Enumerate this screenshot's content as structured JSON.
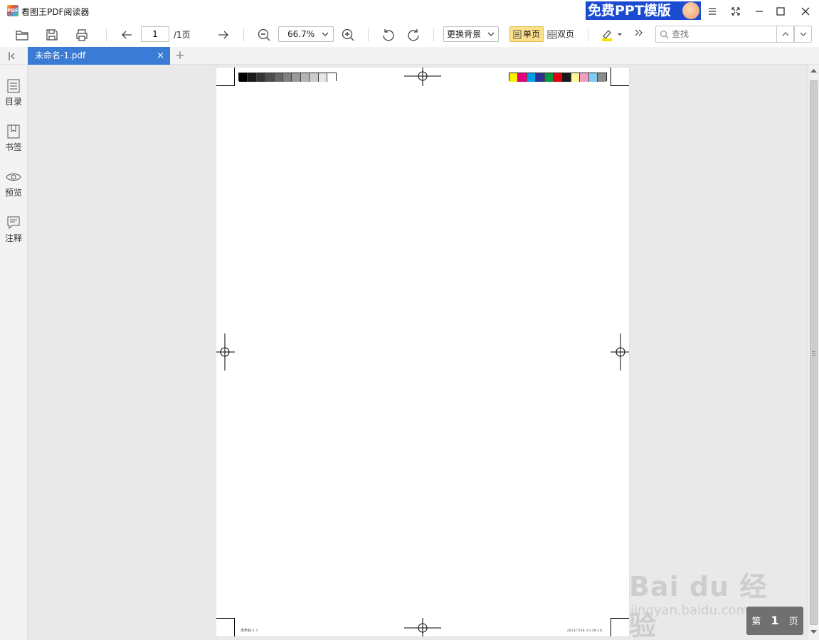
{
  "app": {
    "title": "看图王PDF阅读器",
    "logo_text": "PDF",
    "promo_label": "免费PPT模版"
  },
  "toolbar": {
    "page_current": "1",
    "page_total": "/1页",
    "zoom": "66.7%",
    "background_label": "更换背景",
    "single_page_label": "单页",
    "double_page_label": "双页",
    "search_placeholder": "查找",
    "highlight_color": "#f5e400"
  },
  "tabs": [
    {
      "label": "未命名-1.pdf",
      "close": "×"
    }
  ],
  "add_tab": "+",
  "sidebar": {
    "items": [
      {
        "label": "目录",
        "icon": "list-icon"
      },
      {
        "label": "书签",
        "icon": "bookmark-icon"
      },
      {
        "label": "预览",
        "icon": "eye-icon"
      },
      {
        "label": "注释",
        "icon": "comment-icon"
      }
    ]
  },
  "document": {
    "gray_swatches": [
      "#000000",
      "#1a1a1a",
      "#333333",
      "#4d4d4d",
      "#666666",
      "#808080",
      "#999999",
      "#b3b3b3",
      "#cccccc",
      "#e6e6e6",
      "#ffffff"
    ],
    "color_swatches": [
      "#fff200",
      "#e4007f",
      "#00a0e9",
      "#2e3192",
      "#009944",
      "#e60012",
      "#1a1a1a",
      "#fff799",
      "#f19ec2",
      "#7ecef4",
      "#8c8c8c"
    ],
    "footer_left": "未命名-1  1",
    "footer_right": "2021/7/14  13:39:10"
  },
  "page_indicator": {
    "prefix": "第",
    "number": "1",
    "suffix": "页"
  },
  "watermark": {
    "main": "Bai du 经验",
    "sub": "jingyan.baidu.com"
  }
}
